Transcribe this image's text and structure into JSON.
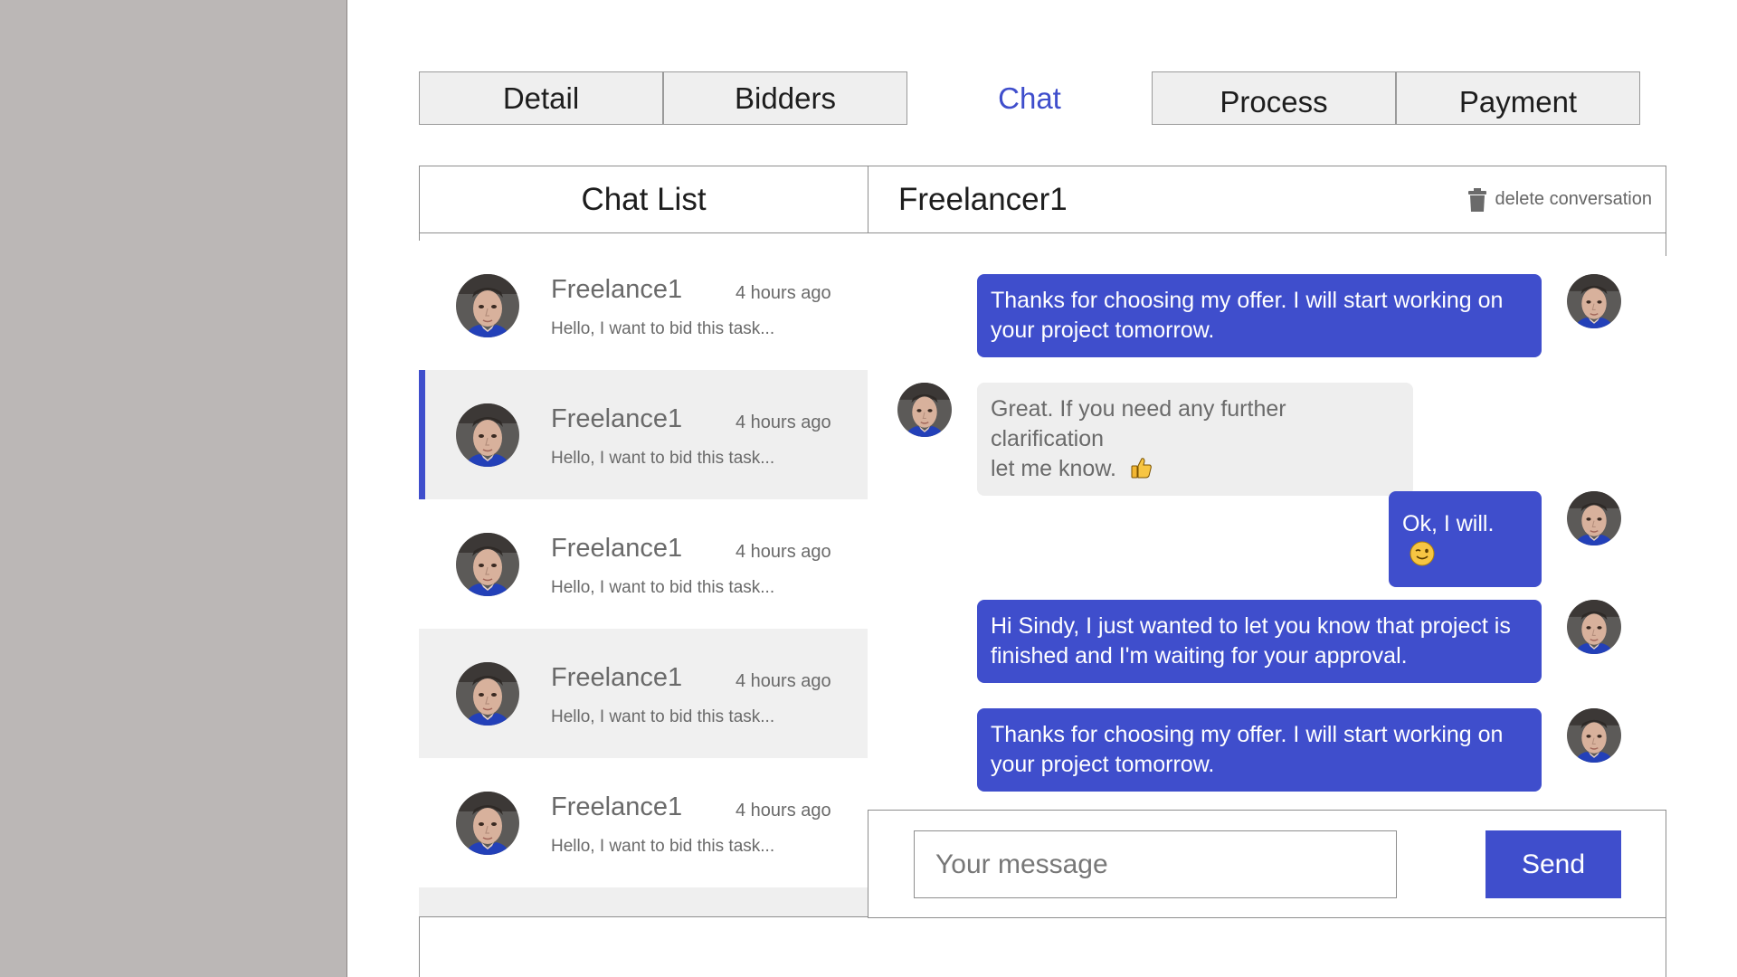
{
  "tabs": {
    "detail": "Detail",
    "bidders": "Bidders",
    "chat": "Chat",
    "process": "Process",
    "payment": "Payment",
    "active": "chat"
  },
  "chat_list": {
    "title": "Chat List",
    "items": [
      {
        "name": "Freelance1",
        "time": "4 hours ago",
        "preview": "Hello, I want to bid this task..."
      },
      {
        "name": "Freelance1",
        "time": "4 hours ago",
        "preview": "Hello, I want to bid this task..."
      },
      {
        "name": "Freelance1",
        "time": "4 hours ago",
        "preview": "Hello, I want to bid this task..."
      },
      {
        "name": "Freelance1",
        "time": "4 hours ago",
        "preview": "Hello, I want to bid this task..."
      },
      {
        "name": "Freelance1",
        "time": "4 hours ago",
        "preview": "Hello, I want to bid this task..."
      }
    ],
    "selected_index": 1
  },
  "conversation": {
    "title": "Freelancer1",
    "delete_label": "delete conversation",
    "messages": [
      {
        "from": "me",
        "lines": [
          "Thanks for choosing my offer. I will start working on",
          "your project tomorrow."
        ]
      },
      {
        "from": "them",
        "lines": [
          "Great. If you need any further clarification",
          "let me know."
        ],
        "emoji": "thumbs-up"
      },
      {
        "from": "me",
        "lines": [
          "Ok, I will."
        ],
        "emoji": "wink"
      },
      {
        "from": "me",
        "lines": [
          "Hi Sindy, I just wanted to let you know that project is",
          "finished and I'm waiting for your approval."
        ]
      },
      {
        "from": "me",
        "lines": [
          "Thanks for choosing my offer. I will start working on",
          "your project tomorrow."
        ]
      }
    ]
  },
  "composer": {
    "placeholder": "Your message",
    "value": "",
    "send_label": "Send"
  },
  "colors": {
    "accent": "#3f4ecc",
    "side_panel": "#bbb7b6",
    "bubble_other": "#eeeeee",
    "tab_bg": "#efefef"
  },
  "icons": {
    "delete": "trash-icon",
    "avatar": "user-avatar"
  }
}
